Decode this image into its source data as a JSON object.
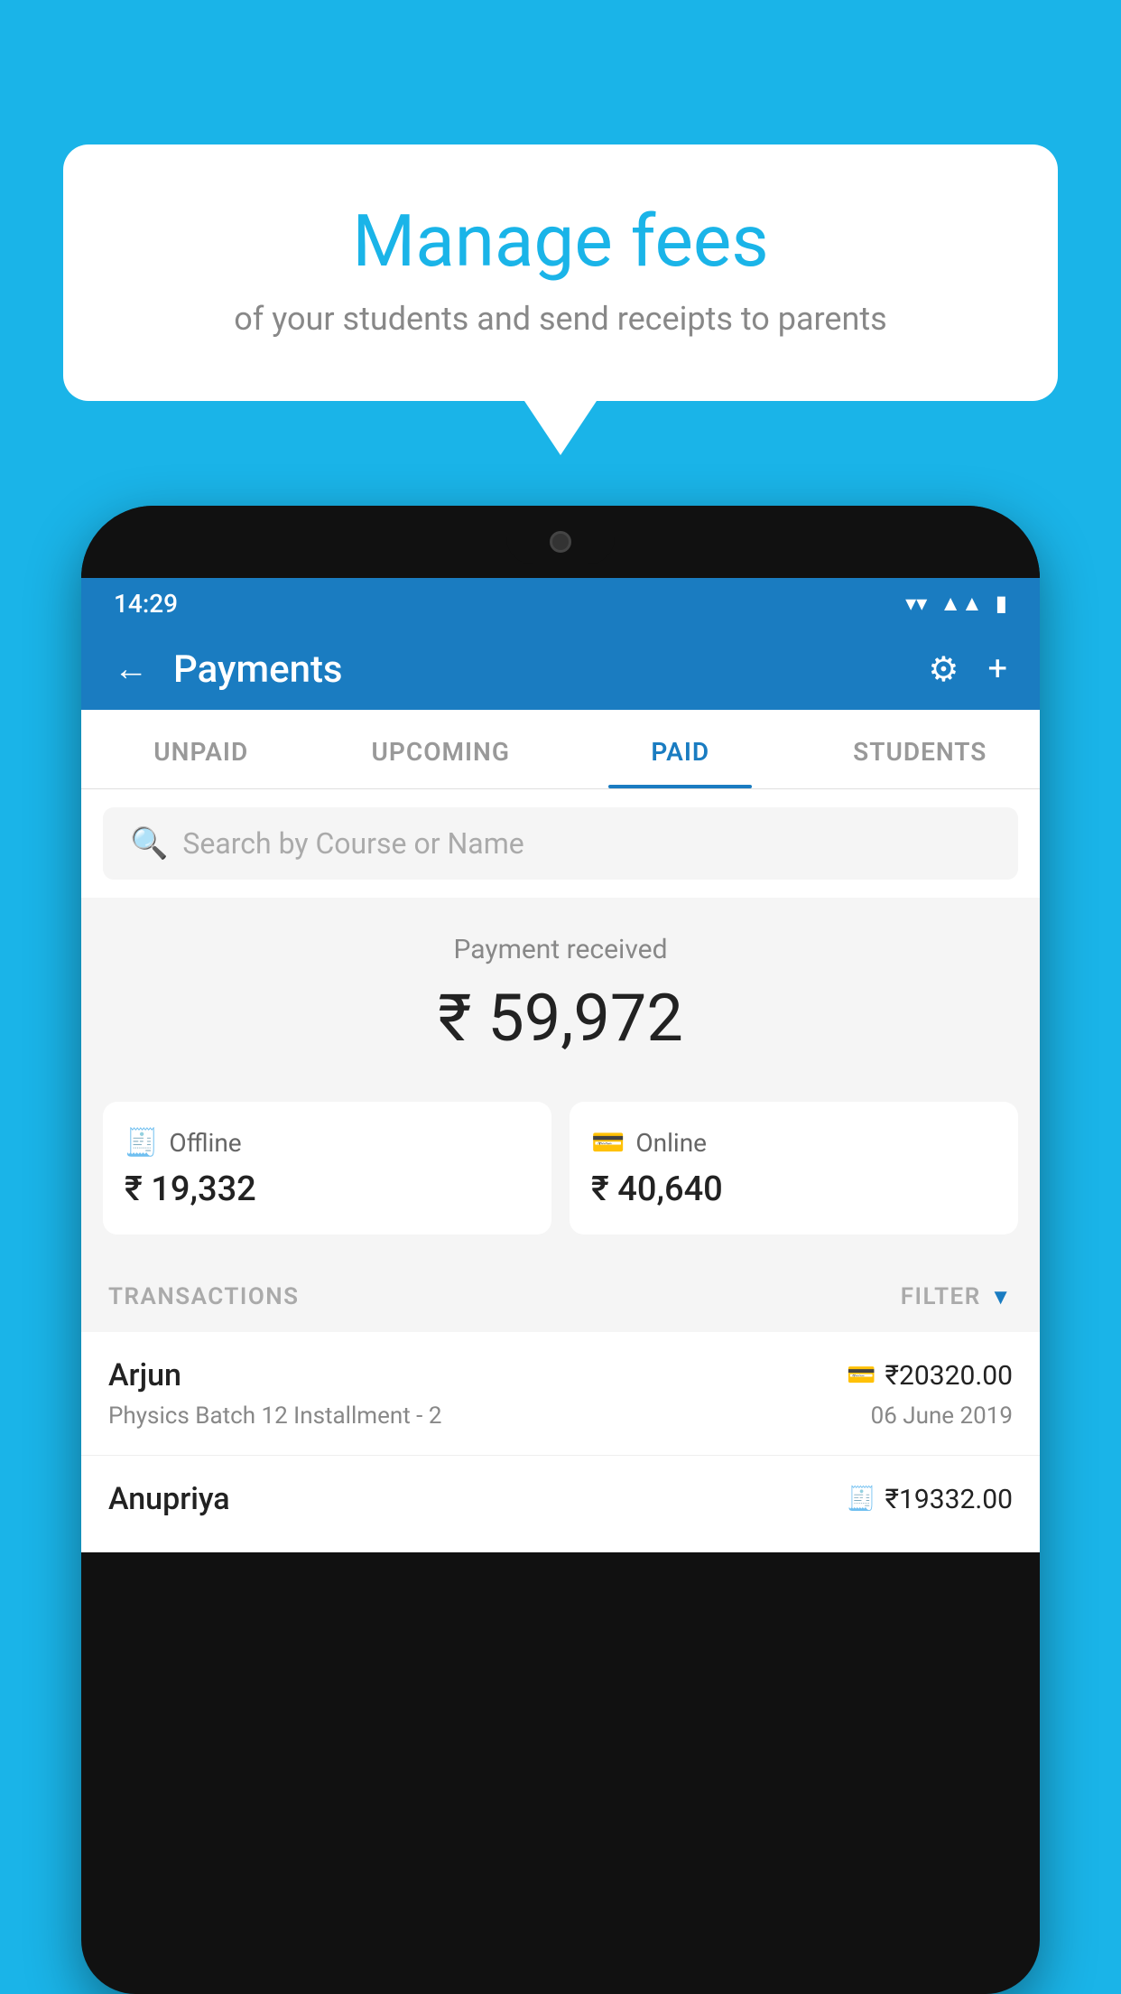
{
  "background_color": "#1ab4e8",
  "speech_bubble": {
    "title": "Manage fees",
    "subtitle": "of your students and send receipts to parents"
  },
  "status_bar": {
    "time": "14:29",
    "wifi": "▾",
    "signal": "▲",
    "battery": "▮"
  },
  "header": {
    "title": "Payments",
    "back_label": "←",
    "gear_label": "⚙",
    "plus_label": "+"
  },
  "tabs": [
    {
      "label": "UNPAID",
      "active": false
    },
    {
      "label": "UPCOMING",
      "active": false
    },
    {
      "label": "PAID",
      "active": true
    },
    {
      "label": "STUDENTS",
      "active": false
    }
  ],
  "search": {
    "placeholder": "Search by Course or Name"
  },
  "payment_received": {
    "label": "Payment received",
    "amount": "₹ 59,972"
  },
  "offline_card": {
    "icon": "💳",
    "label": "Offline",
    "amount": "₹ 19,332"
  },
  "online_card": {
    "icon": "💳",
    "label": "Online",
    "amount": "₹ 40,640"
  },
  "transactions_section": {
    "label": "TRANSACTIONS",
    "filter_label": "FILTER"
  },
  "transactions": [
    {
      "name": "Arjun",
      "payment_type_icon": "💳",
      "amount": "₹20320.00",
      "course": "Physics Batch 12 Installment - 2",
      "date": "06 June 2019"
    },
    {
      "name": "Anupriya",
      "payment_type_icon": "💵",
      "amount": "₹19332.00",
      "course": "",
      "date": ""
    }
  ]
}
